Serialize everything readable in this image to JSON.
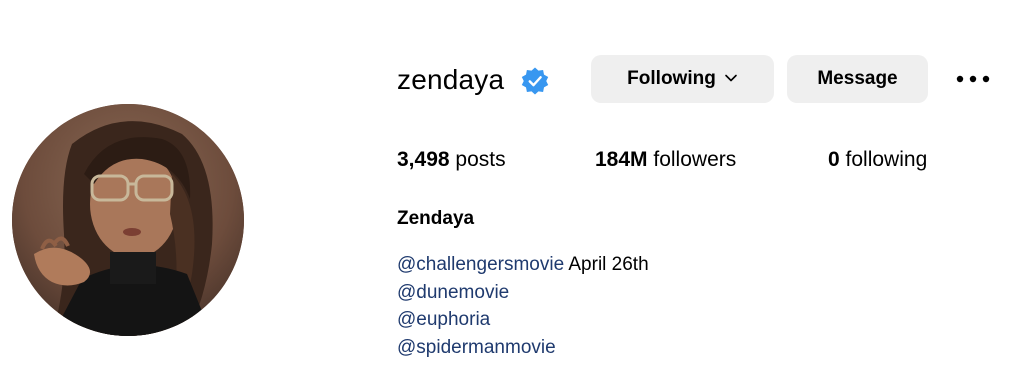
{
  "profile": {
    "username": "zendaya",
    "full_name": "Zendaya",
    "verified_icon": "verified-badge-icon",
    "accent_color": "#3897f0"
  },
  "actions": {
    "following_label": "Following",
    "message_label": "Message",
    "more_icon": "more-options-icon",
    "button_bg": "#efefef"
  },
  "stats": {
    "posts_count": "3,498",
    "posts_label": "posts",
    "followers_count": "184M",
    "followers_label": "followers",
    "following_count": "0",
    "following_label": "following"
  },
  "bio": {
    "lines": [
      {
        "mention": "@challengersmovie",
        "text": " April 26th"
      },
      {
        "mention": "@dunemovie",
        "text": ""
      },
      {
        "mention": "@euphoria",
        "text": ""
      },
      {
        "mention": "@spidermanmovie",
        "text": ""
      }
    ],
    "mention_color": "#1f3a6e"
  }
}
